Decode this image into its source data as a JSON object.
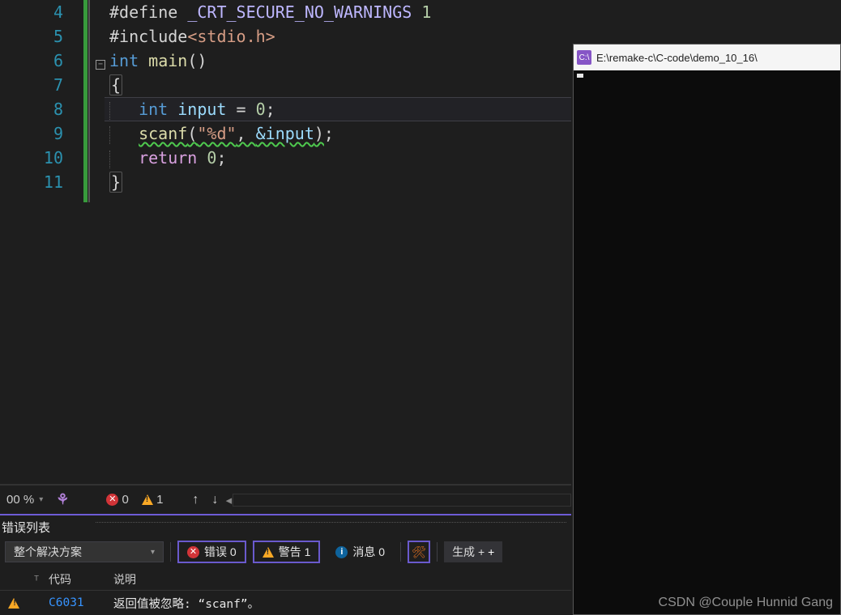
{
  "code": {
    "lines": [
      "4",
      "5",
      "6",
      "7",
      "8",
      "9",
      "10",
      "11"
    ],
    "r4_define": "#define",
    "r4_macro": "_CRT_SECURE_NO_WARNINGS",
    "r4_val": "1",
    "r5_include": "#include",
    "r5_hdr": "stdio.h",
    "r6_type": "int",
    "r6_fn": "main",
    "r7_brace": "{",
    "r8_type": "int",
    "r8_var": "input",
    "r8_eq": " = ",
    "r8_zero": "0",
    "r9_fn": "scanf",
    "r9_fmt": "\"%d\"",
    "r9_addr": "&input",
    "r10_ret": "return",
    "r10_zero": "0",
    "r11_brace": "}",
    "fold_glyph": "−"
  },
  "status": {
    "zoom": "00 %",
    "errors": "0",
    "warnings": "1",
    "up": "↑",
    "down": "↓",
    "scroll_left": "◂"
  },
  "errpanel": {
    "title": "错误列表",
    "scope": "整个解决方案",
    "errors_label": "错误 0",
    "warnings_label": "警告 1",
    "messages_label": "消息 0",
    "filter_icon": "⚲",
    "build_label": "生成 +",
    "grid_x": "ᵀ",
    "col_code": "代码",
    "col_desc": "说明",
    "row_code": "C6031",
    "row_desc": "返回值被忽略: “scanf”。"
  },
  "console": {
    "icon_text": "C:\\",
    "title": "E:\\remake-c\\C-code\\demo_10_16\\",
    "cursor": "_"
  },
  "watermark": "CSDN @Couple Hunnid Gang"
}
